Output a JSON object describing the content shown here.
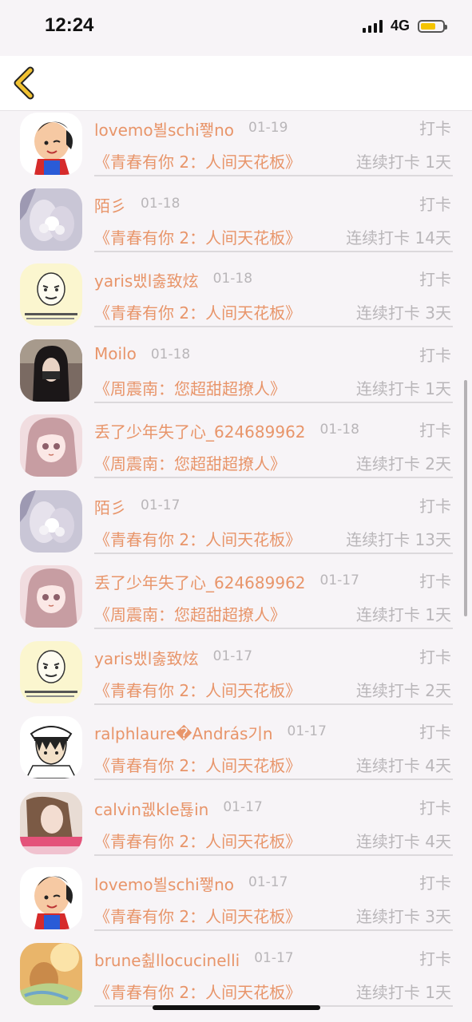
{
  "status_bar": {
    "time": "12:24",
    "network": "4G",
    "battery_level": 0.7,
    "battery_color": "#f5c400"
  },
  "nav": {
    "back_icon": "chevron-left-icon",
    "back_color": "#f1c232"
  },
  "colors": {
    "accent": "#e8956a",
    "muted": "#b9b6b9",
    "background": "#f7f4f7"
  },
  "items": [
    {
      "username": "lovemo뵐schi쬏no",
      "date": "01-19",
      "action": "打卡",
      "topic": "《青春有你 2：人间天花板》",
      "streak": "连续打卡 1天",
      "avatar": "cartoon-baby"
    },
    {
      "username": "陌彡",
      "date": "01-18",
      "action": "打卡",
      "topic": "《青春有你 2：人间天花板》",
      "streak": "连续打卡 14天",
      "avatar": "flower-hands"
    },
    {
      "username": "yaris뱄l춣致炫",
      "date": "01-18",
      "action": "打卡",
      "topic": "《青春有你 2：人间天花板》",
      "streak": "连续打卡 3天",
      "avatar": "meme-face"
    },
    {
      "username": "Moilo",
      "date": "01-18",
      "action": "打卡",
      "topic": "《周震南：您超甜超撩人》",
      "streak": "连续打卡 1天",
      "avatar": "girl-photo"
    },
    {
      "username": "丢了少年失了心_624689962",
      "date": "01-18",
      "action": "打卡",
      "topic": "《周震南：您超甜超撩人》",
      "streak": "连续打卡 2天",
      "avatar": "anime-girl"
    },
    {
      "username": "陌彡",
      "date": "01-17",
      "action": "打卡",
      "topic": "《青春有你 2：人间天花板》",
      "streak": "连续打卡 13天",
      "avatar": "flower-hands"
    },
    {
      "username": "丢了少年失了心_624689962",
      "date": "01-17",
      "action": "打卡",
      "topic": "《周震南：您超甜超撩人》",
      "streak": "连续打卡 1天",
      "avatar": "anime-girl"
    },
    {
      "username": "yaris뱄l춣致炫",
      "date": "01-17",
      "action": "打卡",
      "topic": "《青春有你 2：人间天花板》",
      "streak": "连续打卡 2天",
      "avatar": "meme-face"
    },
    {
      "username": "ralphlaure�András기n",
      "date": "01-17",
      "action": "打卡",
      "topic": "《青春有你 2：人间天花板》",
      "streak": "连续打卡 4天",
      "avatar": "anime-sailor"
    },
    {
      "username": "calvin궶kle툖in",
      "date": "01-17",
      "action": "打卡",
      "topic": "《青春有你 2：人间天花板》",
      "streak": "连续打卡 4天",
      "avatar": "woman-photo"
    },
    {
      "username": "lovemo뵐schi쬏no",
      "date": "01-17",
      "action": "打卡",
      "topic": "《青春有你 2：人间天花板》",
      "streak": "连续打卡 3天",
      "avatar": "cartoon-baby"
    },
    {
      "username": "brune췶llocucinelli",
      "date": "01-17",
      "action": "打卡",
      "topic": "《青春有你 2：人间天花板》",
      "streak": "连续打卡 1天",
      "avatar": "warm-photo"
    }
  ]
}
